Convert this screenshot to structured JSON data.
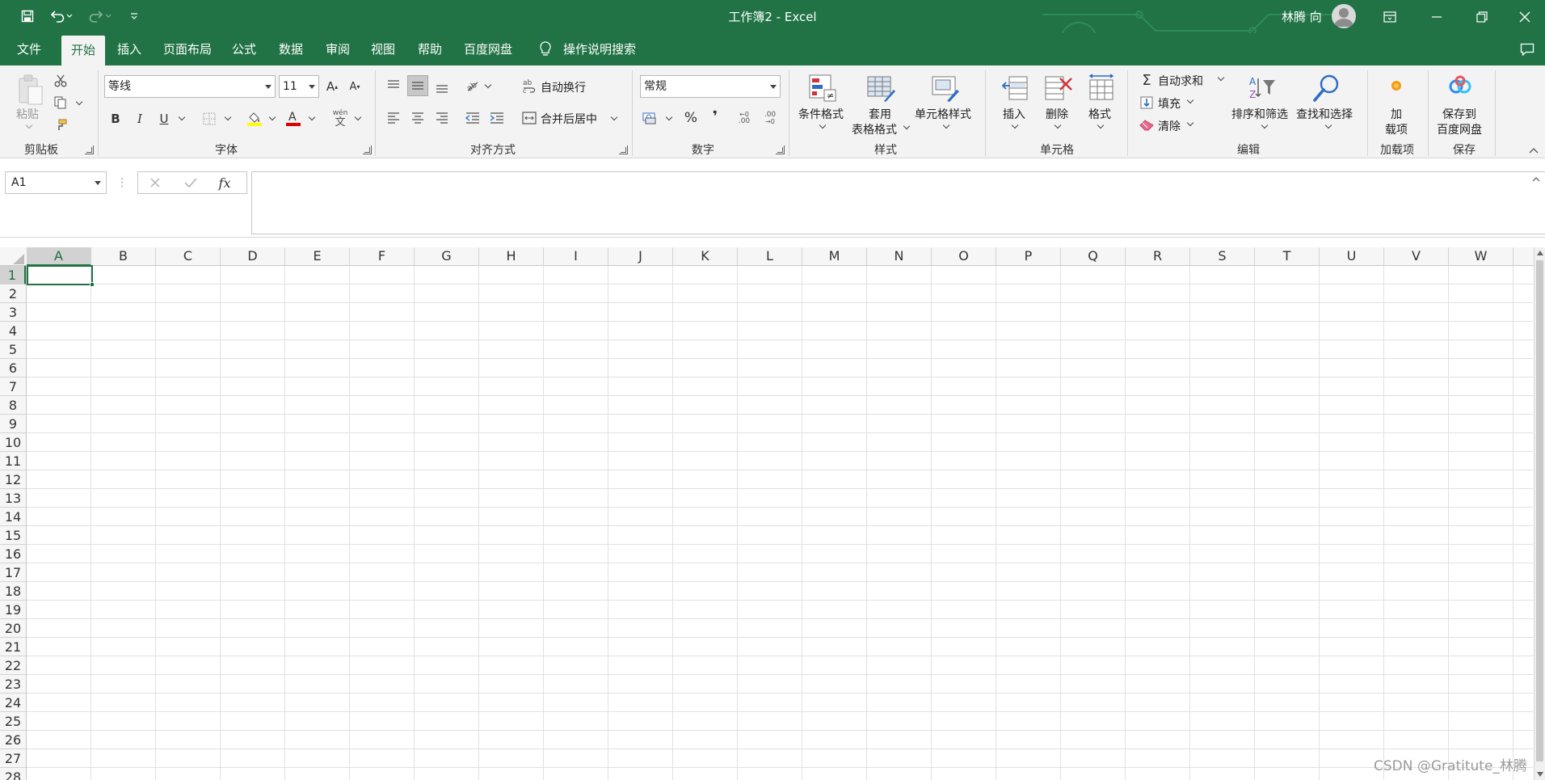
{
  "window": {
    "title": "工作簿2  -  Excel",
    "user": "林腾 向"
  },
  "tabs": [
    "文件",
    "开始",
    "插入",
    "页面布局",
    "公式",
    "数据",
    "审阅",
    "视图",
    "帮助",
    "百度网盘"
  ],
  "active_tab": "开始",
  "tell_me": "操作说明搜索",
  "ribbon": {
    "clipboard": {
      "paste": "粘贴",
      "label": "剪贴板"
    },
    "font": {
      "name": "等线",
      "size": "11",
      "label": "字体",
      "bold": "B",
      "italic": "I",
      "underline": "U",
      "grow": "A",
      "shrink": "A",
      "pinyin": "wén",
      "pinyin_char": "文"
    },
    "alignment": {
      "wrap": "自动换行",
      "merge": "合并后居中",
      "label": "对齐方式"
    },
    "number": {
      "format": "常规",
      "percent": "%",
      "comma": "❜",
      "inc_decimal": ".00",
      "dec_decimal": ".00",
      "label": "数字"
    },
    "styles": {
      "conditional": "条件格式",
      "table_line1": "套用",
      "table_line2": "表格格式",
      "cell_styles": "单元格样式",
      "label": "样式"
    },
    "cells": {
      "insert": "插入",
      "delete": "删除",
      "format": "格式",
      "label": "单元格"
    },
    "editing": {
      "autosum": "自动求和",
      "fill": "填充",
      "clear": "清除",
      "sort": "排序和筛选",
      "find": "查找和选择",
      "label": "编辑"
    },
    "addins": {
      "line1": "加",
      "line2": "载项",
      "label": "加载项"
    },
    "save": {
      "line1": "保存到",
      "line2": "百度网盘",
      "label": "保存"
    }
  },
  "formula_bar": {
    "name_box": "A1",
    "fx": "fx",
    "content": ""
  },
  "columns": [
    "A",
    "B",
    "C",
    "D",
    "E",
    "F",
    "G",
    "H",
    "I",
    "J",
    "K",
    "L",
    "M",
    "N",
    "O",
    "P",
    "Q",
    "R",
    "S",
    "T",
    "U",
    "V",
    "W"
  ],
  "rows": [
    "1",
    "2",
    "3",
    "4",
    "5",
    "6",
    "7",
    "8",
    "9",
    "10",
    "11",
    "12",
    "13",
    "14",
    "15",
    "16",
    "17",
    "18",
    "19",
    "20",
    "21",
    "22",
    "23",
    "24",
    "25",
    "26",
    "27",
    "28"
  ],
  "selected_cell": {
    "column": "A",
    "row": "1"
  },
  "watermark": "CSDN @Gratitute_林腾",
  "colors": {
    "accent": "#217346",
    "ribbon_bg": "#f3f3f3"
  }
}
